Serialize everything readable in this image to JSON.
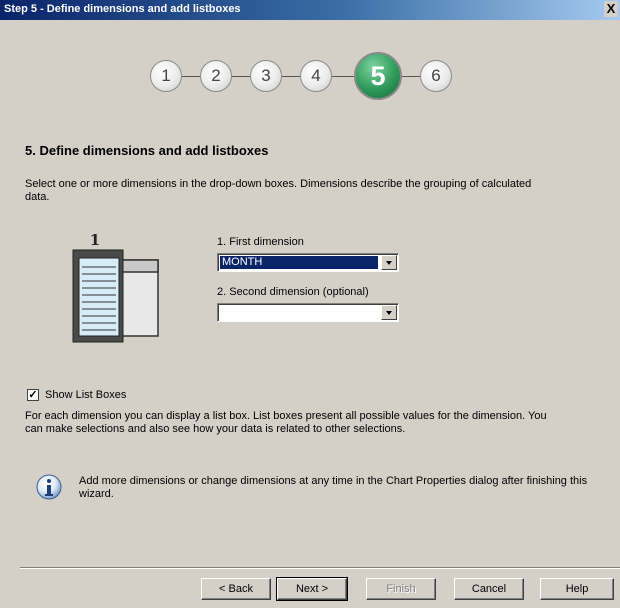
{
  "window": {
    "title": "Step 5 - Define dimensions and add listboxes",
    "close_glyph": "X"
  },
  "steps": [
    {
      "label": "1"
    },
    {
      "label": "2"
    },
    {
      "label": "3"
    },
    {
      "label": "4"
    },
    {
      "label": "5"
    },
    {
      "label": "6"
    }
  ],
  "active_step": "5",
  "heading": "5. Define dimensions and add listboxes",
  "description": "Select one or more dimensions in the drop-down boxes. Dimensions describe the grouping of calculated data.",
  "illustration": {
    "badge": "1",
    "icon": "listbox-illustration-icon"
  },
  "first_dimension": {
    "label": "1. First dimension",
    "value": "MONTH"
  },
  "second_dimension": {
    "label": "2. Second dimension (optional)",
    "value": ""
  },
  "show_list_boxes": {
    "label": "Show List Boxes",
    "checked": true
  },
  "list_box_description": "For each dimension you can display a list box. List boxes present all possible values for the dimension. You can make selections and also see how your data is related to other selections.",
  "info": {
    "icon": "info-icon",
    "text": "Add more dimensions or change dimensions at any time in the Chart Properties dialog after finishing this wizard."
  },
  "buttons": {
    "back": "< Back",
    "next": "Next >",
    "finish": "Finish",
    "cancel": "Cancel",
    "help": "Help"
  },
  "colors": {
    "title_bar": "#0a246a",
    "active_step": "#2e9a5a",
    "selection": "#0a246a",
    "dialog_bg": "#d4d0c8"
  }
}
